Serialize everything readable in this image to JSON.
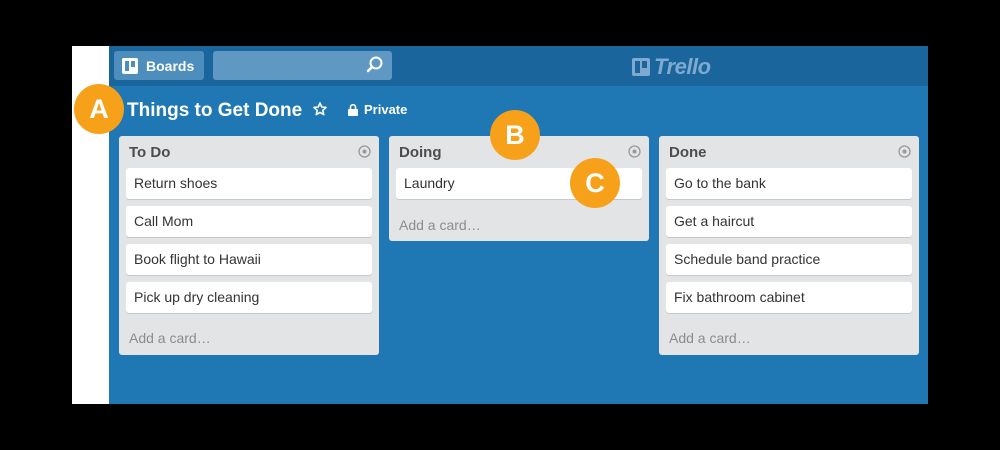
{
  "header": {
    "boards_label": "Boards",
    "search_placeholder": "",
    "logo_text": "Trello"
  },
  "board": {
    "title": "Things to Get Done",
    "visibility": "Private"
  },
  "lists": [
    {
      "title": "To Do",
      "cards": [
        "Return shoes",
        "Call Mom",
        "Book flight to Hawaii",
        "Pick up dry cleaning"
      ],
      "add_card": "Add a card…"
    },
    {
      "title": "Doing",
      "cards": [
        "Laundry"
      ],
      "add_card": "Add a card…"
    },
    {
      "title": "Done",
      "cards": [
        "Go to the bank",
        "Get a haircut",
        "Schedule band practice",
        "Fix bathroom cabinet"
      ],
      "add_card": "Add a card…"
    }
  ],
  "callouts": [
    "A",
    "B",
    "C"
  ],
  "colors": {
    "board_bg": "#1F78B4",
    "header_bg": "#1A659B",
    "list_bg": "#E2E4E6",
    "callout": "#F7A11A"
  }
}
